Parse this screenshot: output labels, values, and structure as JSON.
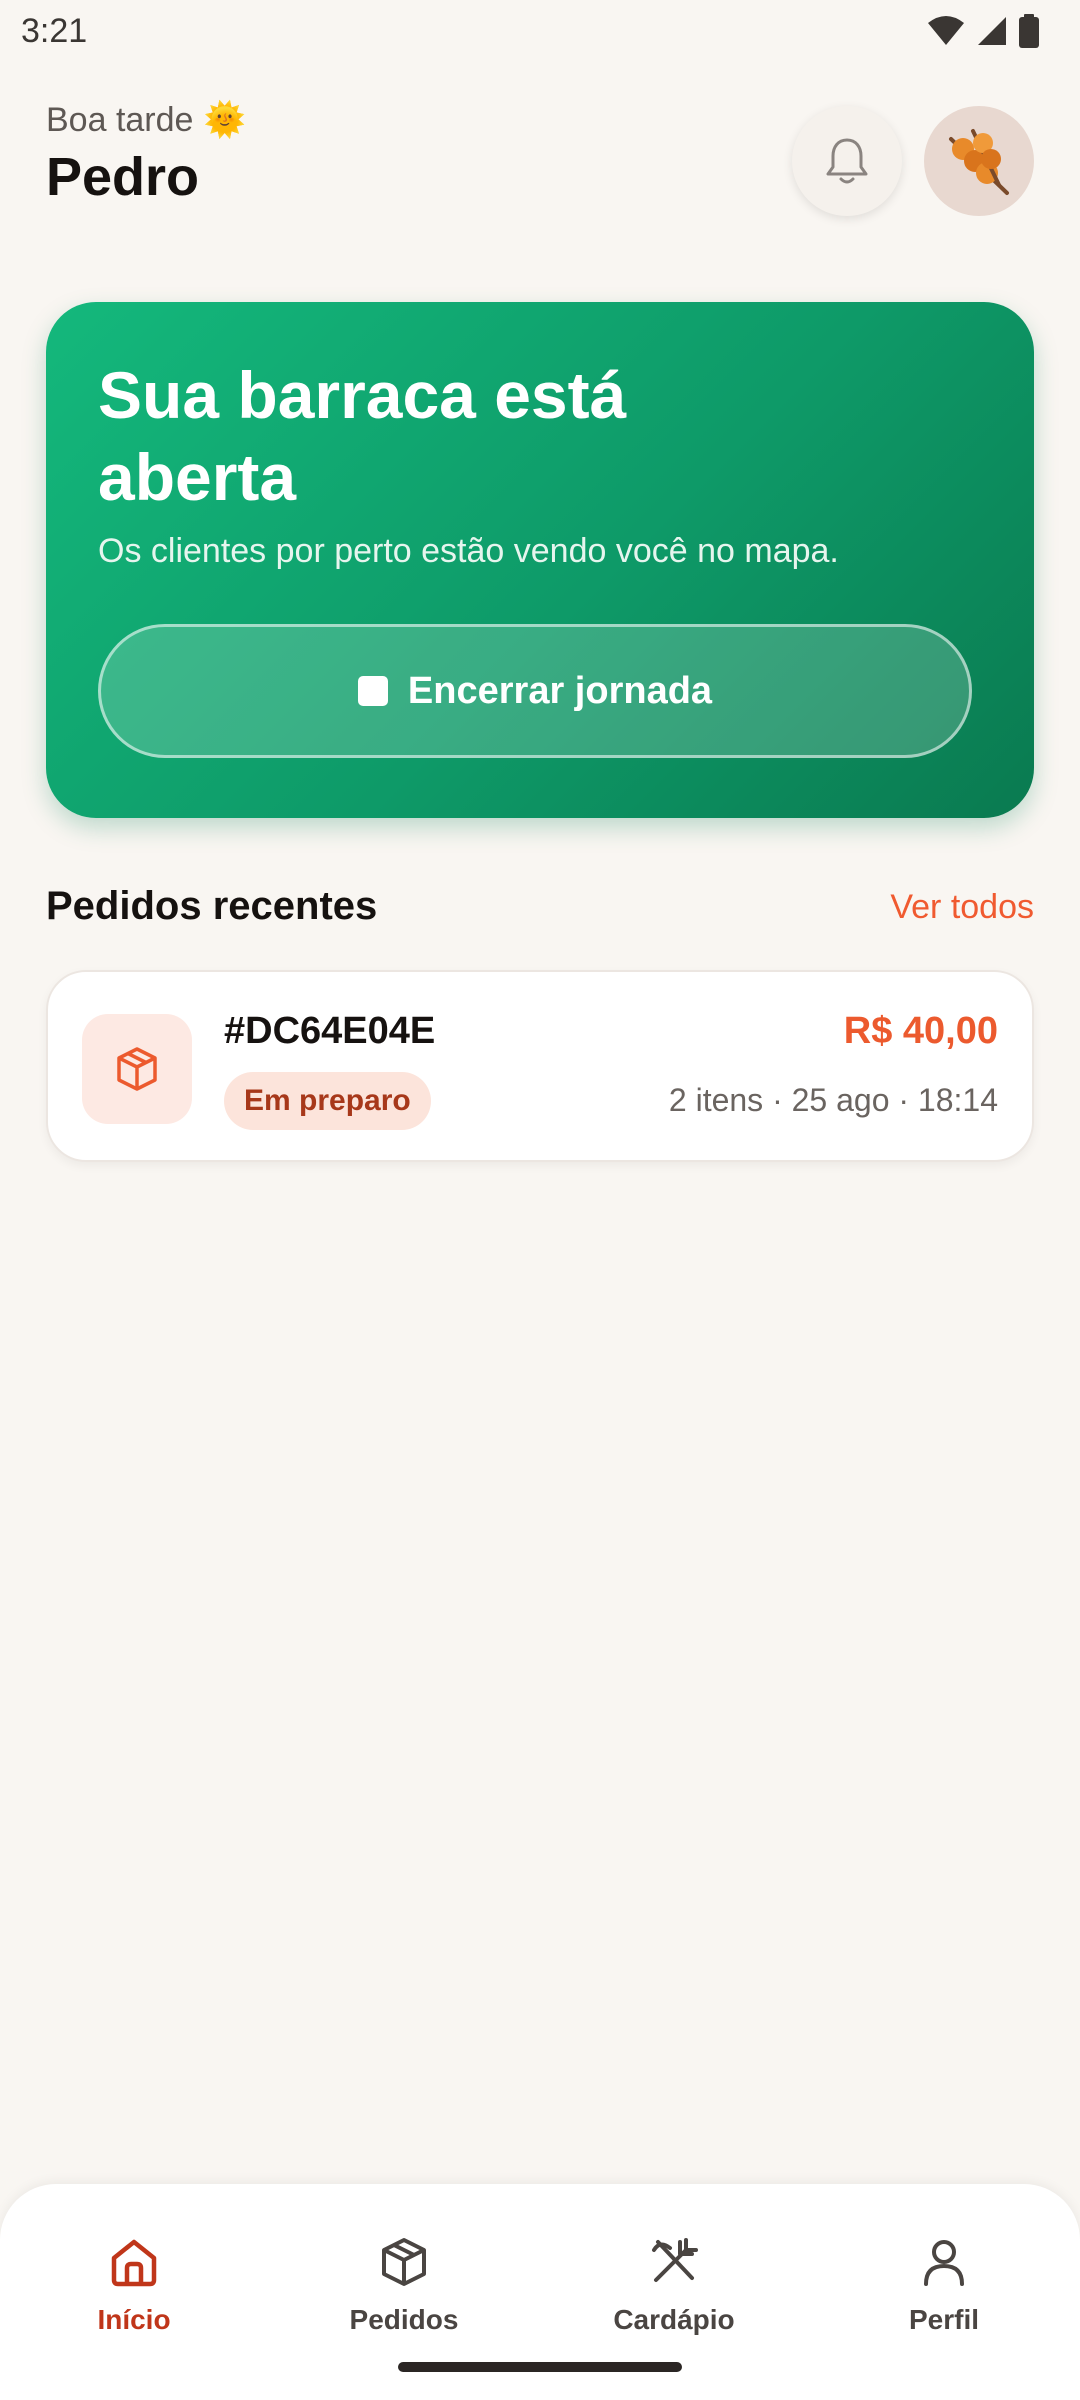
{
  "status_bar": {
    "time": "3:21"
  },
  "header": {
    "greeting": "Boa tarde",
    "greeting_emoji": "🌞",
    "user_name": "Pedro",
    "notification_icon": "bell-icon",
    "avatar_icon": "skewer-avatar"
  },
  "hero": {
    "title": "Sua barraca está aberta",
    "subtitle": "Os clientes por perto estão vendo você no mapa.",
    "end_button_label": "Encerrar jornada"
  },
  "recent_orders": {
    "title": "Pedidos recentes",
    "see_all_label": "Ver todos",
    "orders": [
      {
        "id": "#DC64E04E",
        "price": "R$ 40,00",
        "status": "Em preparo",
        "meta": "2 itens · 25 ago · 18:14"
      }
    ]
  },
  "bottom_nav": {
    "items": [
      {
        "label": "Início",
        "icon": "home-icon",
        "active": true
      },
      {
        "label": "Pedidos",
        "icon": "package-icon",
        "active": false
      },
      {
        "label": "Cardápio",
        "icon": "utensils-crossed-icon",
        "active": false
      },
      {
        "label": "Perfil",
        "icon": "user-icon",
        "active": false
      }
    ]
  },
  "colors": {
    "accent": "#EC5A2E",
    "hero_green": "#0E9A68",
    "background": "#F9F6F2"
  }
}
